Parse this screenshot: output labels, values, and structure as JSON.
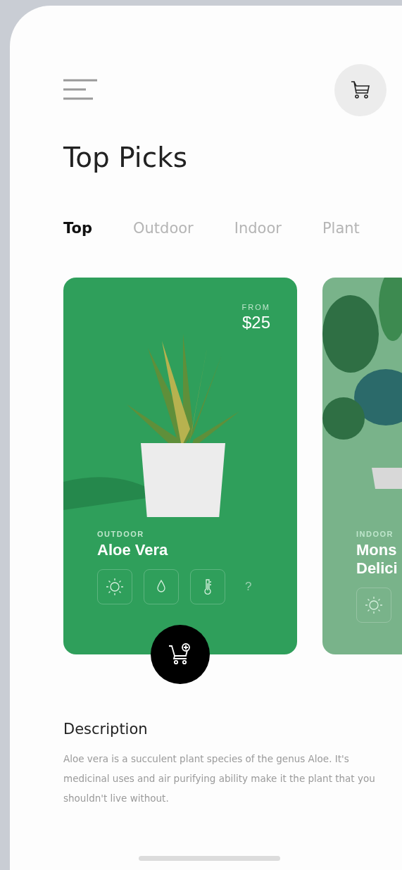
{
  "header": {
    "title": "Top Picks"
  },
  "tabs": [
    {
      "label": "Top",
      "selected": true
    },
    {
      "label": "Outdoor",
      "selected": false
    },
    {
      "label": "Indoor",
      "selected": false
    },
    {
      "label": "Plant",
      "selected": false
    }
  ],
  "cards": [
    {
      "category": "OUTDOOR",
      "name_lines": [
        "Aloe Vera"
      ],
      "price_label": "FROM",
      "price": "$25",
      "color": "#2f9f5b",
      "kind": "succulent",
      "add_button": true,
      "features": [
        {
          "kind": "sun"
        },
        {
          "kind": "drop"
        },
        {
          "kind": "thermometer"
        },
        {
          "kind": "more",
          "text": "?"
        }
      ]
    },
    {
      "category": "INDOOR",
      "name_lines": [
        "Mons",
        "Delici"
      ],
      "color": "#79b38a",
      "kind": "leafy",
      "add_button": false,
      "features": [
        {
          "kind": "sun"
        }
      ]
    }
  ],
  "description": {
    "heading": "Description",
    "text": "Aloe vera is a succulent plant species of the genus Aloe. It's medicinal uses and air purifying ability make it the plant that you shouldn't live without."
  }
}
